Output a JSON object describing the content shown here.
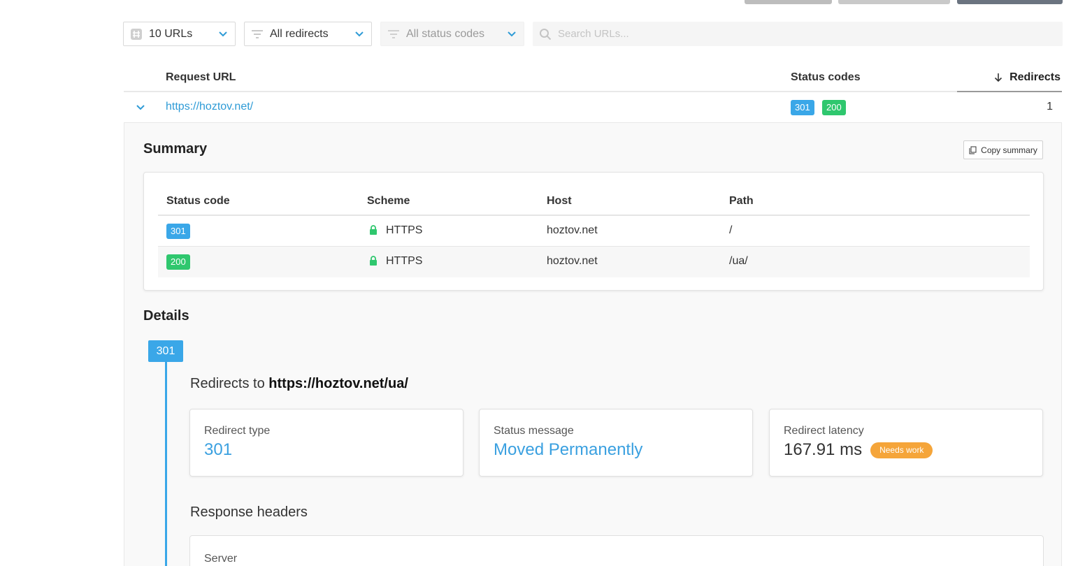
{
  "filters": {
    "urls_label": "10 URLs",
    "redirects_label": "All redirects",
    "status_label": "All status codes",
    "search_placeholder": "Search URLs..."
  },
  "table": {
    "columns": [
      "Request URL",
      "Status codes",
      "Redirects"
    ],
    "row": {
      "url": "https://hoztov.net/",
      "codes": [
        "301",
        "200"
      ],
      "redirects": "1"
    }
  },
  "summary": {
    "title": "Summary",
    "copy_label": "Copy summary",
    "columns": [
      "Status code",
      "Scheme",
      "Host",
      "Path"
    ],
    "rows": [
      {
        "code": "301",
        "scheme": "HTTPS",
        "host": "hoztov.net",
        "path": "/"
      },
      {
        "code": "200",
        "scheme": "HTTPS",
        "host": "hoztov.net",
        "path": "/ua/"
      }
    ]
  },
  "details": {
    "title": "Details",
    "step_code": "301",
    "redirects_prefix": "Redirects to",
    "redirects_target": "https://hoztov.net/ua/",
    "cards": [
      {
        "label": "Redirect type",
        "value": "301"
      },
      {
        "label": "Status message",
        "value": "Moved Permanently"
      },
      {
        "label": "Redirect latency",
        "value": "167.91 ms",
        "tag": "Needs work"
      }
    ],
    "response_headers_title": "Response headers",
    "first_header": "Server"
  },
  "colors": {
    "accent": "#3aa7e8",
    "success": "#2fc76e",
    "warning": "#f5a53a",
    "link": "#2e9bd6"
  }
}
